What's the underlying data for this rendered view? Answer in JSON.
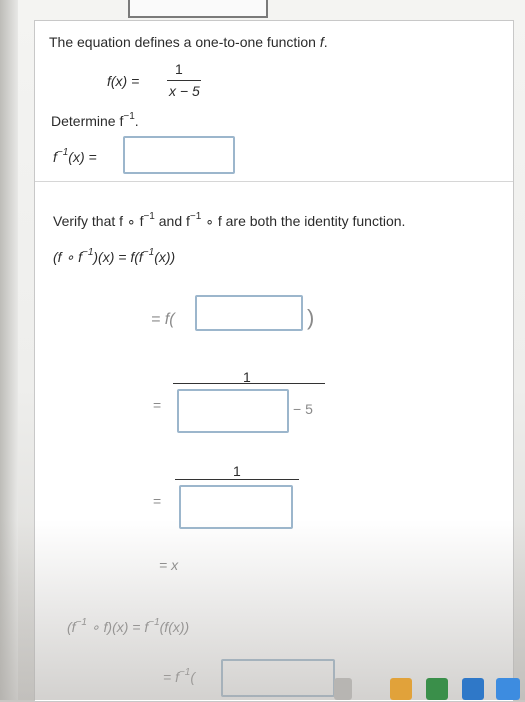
{
  "problem": {
    "intro": "The equation defines a one-to-one function",
    "intro_f": "f",
    "fx_label": "f(x) =",
    "numerator": "1",
    "denominator": "x − 5",
    "determine": "Determine f",
    "determine_sup": "−1",
    "inverse_label_f": "f",
    "inverse_label_sup": "−1",
    "inverse_label_rest": "(x) =",
    "verify_a": "Verify that f ∘ f",
    "verify_sup1": "−1",
    "verify_b": " and f",
    "verify_sup2": "−1",
    "verify_c": " ∘ f are both the identity function.",
    "comp1_left": "(f ∘ f",
    "comp1_sup": "−1",
    "comp1_mid": ")(x) = f(f",
    "comp1_sup2": "−1",
    "comp1_right": "(x))",
    "step1_eq": "= f(",
    "step1_close": ")",
    "step2_eq": "=",
    "step2_num": "1",
    "step2_minus": "− 5",
    "step3_eq": "=",
    "step3_num": "1",
    "step4": "= x",
    "comp2_left": "(f",
    "comp2_sup": "−1",
    "comp2_mid": " ∘ f)(x) = f",
    "comp2_sup2": "−1",
    "comp2_right": "(f(x))",
    "comp2_step": "= f",
    "comp2_step_sup": "−1",
    "comp2_step_rest": "("
  }
}
